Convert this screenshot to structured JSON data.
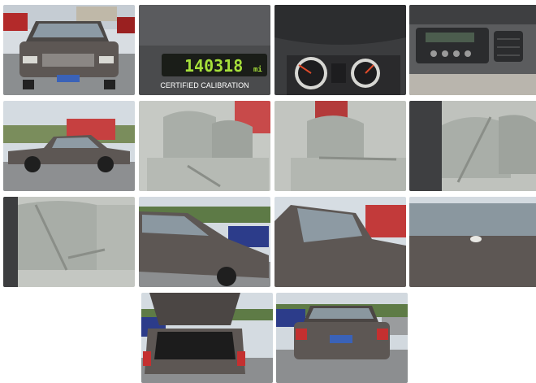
{
  "gallery": {
    "photos": [
      {
        "subject": "car-front-exterior"
      },
      {
        "subject": "odometer-display",
        "odometer_reading": "140318",
        "odometer_unit": "mi",
        "caption": "CERTIFIED CALIBRATION"
      },
      {
        "subject": "instrument-cluster"
      },
      {
        "subject": "dashboard-radio"
      },
      {
        "subject": "car-side-exterior"
      },
      {
        "subject": "front-seats"
      },
      {
        "subject": "front-seats-passenger"
      },
      {
        "subject": "rear-seat-view"
      },
      {
        "subject": "rear-seat"
      },
      {
        "subject": "car-rear-quarter"
      },
      {
        "subject": "car-rear-window"
      },
      {
        "subject": "trunk-lid"
      },
      {
        "subject": "open-trunk"
      },
      {
        "subject": "car-rear-exterior"
      }
    ]
  },
  "colors": {
    "car_body": "#5d5754",
    "sky": "#d6dde3",
    "asphalt": "#8a8d8f",
    "interior_cloth": "#a9aea8",
    "odometer_green": "#a6e03a"
  }
}
